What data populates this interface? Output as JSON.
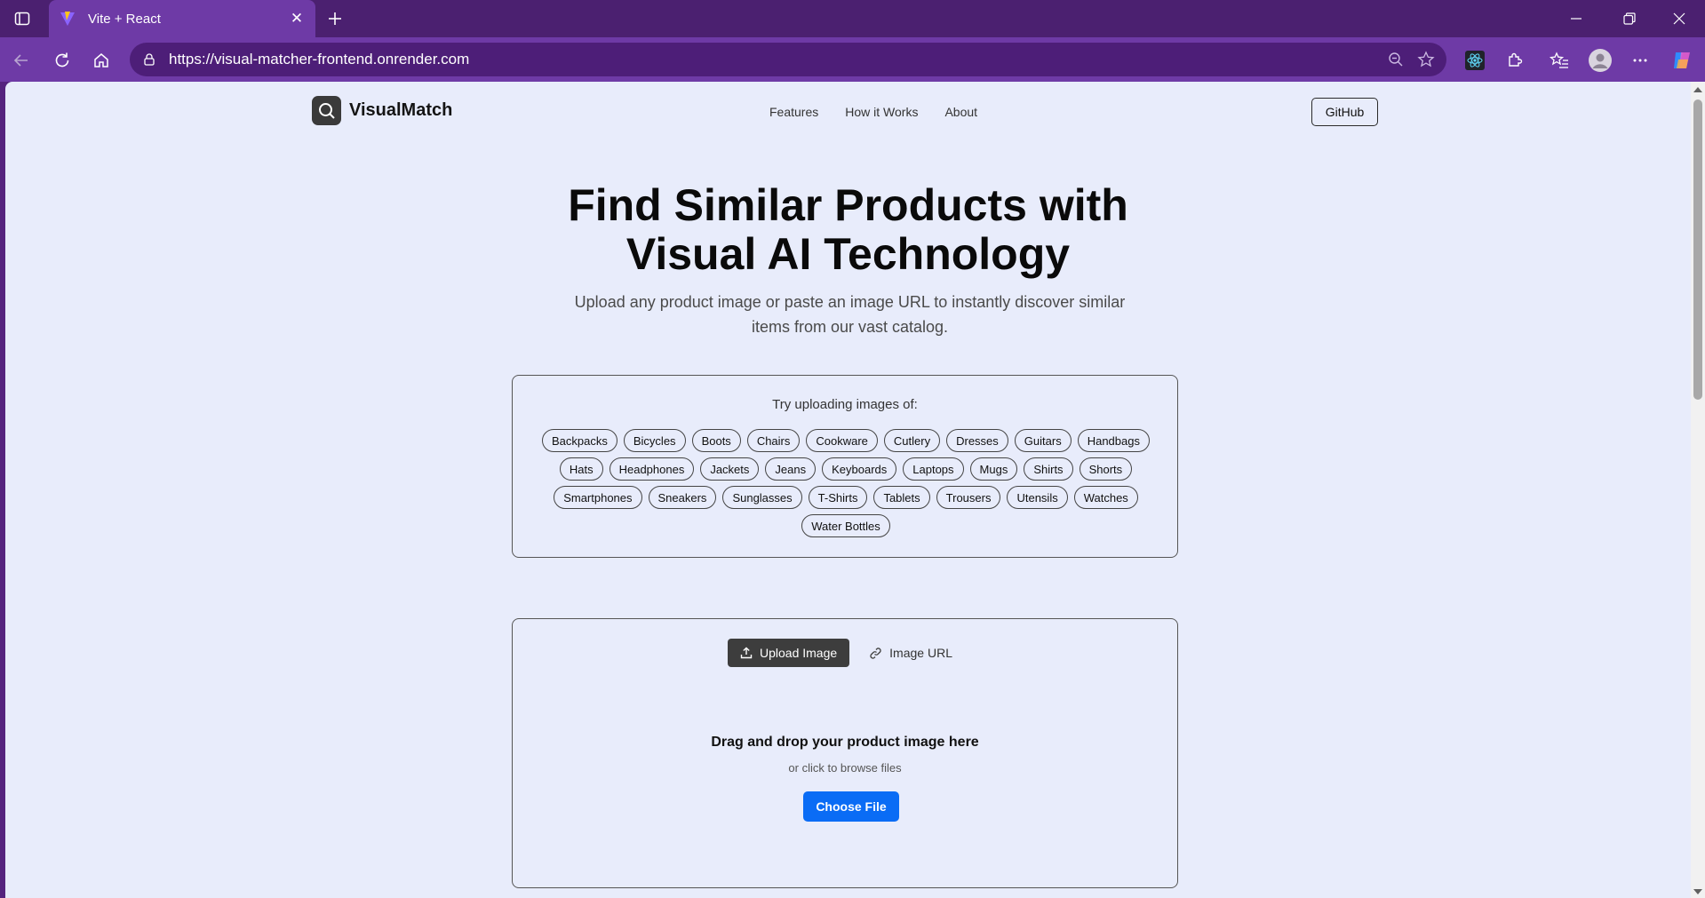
{
  "browser": {
    "tab_title": "Vite + React",
    "url": "https://visual-matcher-frontend.onrender.com",
    "accent": "#6e3aa6"
  },
  "nav": {
    "brand": "VisualMatch",
    "links": [
      "Features",
      "How it Works",
      "About"
    ],
    "github": "GitHub"
  },
  "hero": {
    "title_line1": "Find Similar Products with",
    "title_line2": "Visual AI Technology",
    "subtitle_line1": "Upload any product image or paste an image URL to instantly discover similar",
    "subtitle_line2": "items from our vast catalog."
  },
  "suggestions": {
    "label": "Try uploading images of:",
    "items": [
      "Backpacks",
      "Bicycles",
      "Boots",
      "Chairs",
      "Cookware",
      "Cutlery",
      "Dresses",
      "Guitars",
      "Handbags",
      "Hats",
      "Headphones",
      "Jackets",
      "Jeans",
      "Keyboards",
      "Laptops",
      "Mugs",
      "Shirts",
      "Shorts",
      "Smartphones",
      "Sneakers",
      "Sunglasses",
      "T-Shirts",
      "Tablets",
      "Trousers",
      "Utensils",
      "Watches",
      "Water Bottles"
    ]
  },
  "upload": {
    "tab_upload": "Upload Image",
    "tab_url": "Image URL",
    "drop_title": "Drag and drop your product image here",
    "drop_sub": "or click to browse files",
    "choose_button": "Choose File",
    "button_color": "#0a6cf5"
  }
}
